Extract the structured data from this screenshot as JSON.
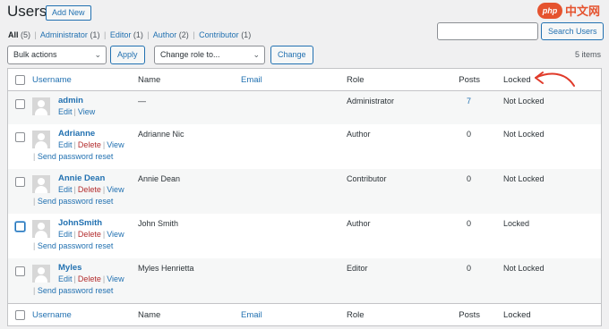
{
  "header": {
    "title": "Users",
    "add_new_label": "Add New"
  },
  "watermark": {
    "logo_text": "php",
    "text": "中文网"
  },
  "filters": {
    "all_label": "All",
    "all_count": "(5)",
    "administrator_label": "Administrator",
    "administrator_count": "(1)",
    "editor_label": "Editor",
    "editor_count": "(1)",
    "author_label": "Author",
    "author_count": "(2)",
    "contributor_label": "Contributor",
    "contributor_count": "(1)",
    "separator": "|"
  },
  "search": {
    "value": "",
    "button_label": "Search Users"
  },
  "bulk_actions": {
    "selected": "Bulk actions",
    "apply_label": "Apply"
  },
  "change_role": {
    "selected": "Change role to...",
    "change_label": "Change"
  },
  "items_count": "5 items",
  "columns": {
    "username": "Username",
    "name": "Name",
    "email": "Email",
    "role": "Role",
    "posts": "Posts",
    "locked": "Locked"
  },
  "row_actions": {
    "edit": "Edit",
    "view": "View",
    "delete": "Delete",
    "send_reset": "Send password reset",
    "sep": "|"
  },
  "users": [
    {
      "username": "admin",
      "name": "—",
      "email": "",
      "role": "Administrator",
      "posts": "7",
      "locked": "Not Locked"
    },
    {
      "username": "Adrianne",
      "name": "Adrianne Nic",
      "email": "",
      "role": "Author",
      "posts": "0",
      "locked": "Not Locked"
    },
    {
      "username": "Annie Dean",
      "name": "Annie Dean",
      "email": "",
      "role": "Contributor",
      "posts": "0",
      "locked": "Not Locked"
    },
    {
      "username": "JohnSmith",
      "name": "John Smith",
      "email": "",
      "role": "Author",
      "posts": "0",
      "locked": "Locked"
    },
    {
      "username": "Myles",
      "name": "Myles Henrietta",
      "email": "",
      "role": "Editor",
      "posts": "0",
      "locked": "Not Locked"
    }
  ],
  "colors": {
    "accent": "#2271b1",
    "delete": "#b32d2e",
    "arrow": "#e03a2a",
    "row_alt": "#f6f7f7"
  }
}
